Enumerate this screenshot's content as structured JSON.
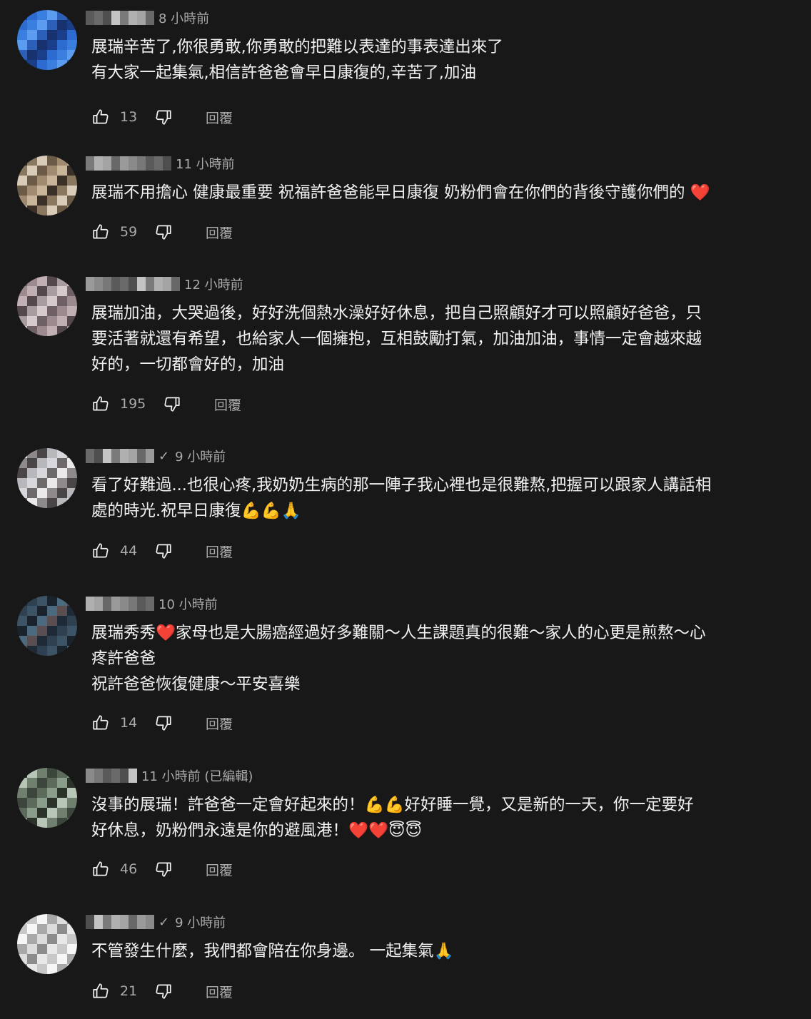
{
  "comments": [
    {
      "time": "8 小時前",
      "verified": false,
      "text": "展瑞辛苦了,你很勇敢,你勇敢的把難以表達的事表達出來了\n有大家一起集氣,相信許爸爸會早日康復的,辛苦了,加油",
      "likes": "13",
      "reply_label": "回覆"
    },
    {
      "time": "11 小時前",
      "verified": false,
      "text": "展瑞不用擔心 健康最重要 祝福許爸爸能早日康復 奶粉們會在你們的背後守護你們的 ❤️",
      "likes": "59",
      "reply_label": "回覆"
    },
    {
      "time": "12 小時前",
      "verified": false,
      "text": "展瑞加油，大哭過後，好好洗個熱水澡好好休息，把自己照顧好才可以照顧好爸爸，只\n要活著就還有希望，也給家人一個擁抱，互相鼓勵打氣，加油加油，事情一定會越來越\n好的，一切都會好的，加油",
      "likes": "195",
      "reply_label": "回覆"
    },
    {
      "time": "9 小時前",
      "verified": true,
      "text": "看了好難過...也很心疼,我奶奶生病的那一陣子我心裡也是很難熬,把握可以跟家人講話相\n處的時光.祝早日康復💪💪🙏",
      "likes": "44",
      "reply_label": "回覆"
    },
    {
      "time": "10 小時前",
      "verified": false,
      "text": "展瑞秀秀❤️家母也是大腸癌經過好多難關～人生課題真的很難～家人的心更是煎熬～心\n疼許爸爸\n祝許爸爸恢復健康～平安喜樂",
      "likes": "14",
      "reply_label": "回覆"
    },
    {
      "time": "11 小時前 (已編輯)",
      "verified": false,
      "text": "沒事的展瑞！許爸爸一定會好起來的！💪💪好好睡一覺，又是新的一天，你一定要好\n好休息，奶粉們永遠是你的避風港！❤️❤️😇😇",
      "likes": "46",
      "reply_label": "回覆"
    },
    {
      "time": "9 小時前",
      "verified": true,
      "text": "不管發生什麼，我們都會陪在你身邊。 一起集氣🙏",
      "likes": "21",
      "reply_label": "回覆"
    }
  ],
  "colors": {
    "background": "#181818",
    "text": "#f1f1f1",
    "secondary": "#aaaaaa"
  },
  "icons": {
    "like": "thumbs-up-icon",
    "dislike": "thumbs-down-icon",
    "verified": "check-icon"
  }
}
